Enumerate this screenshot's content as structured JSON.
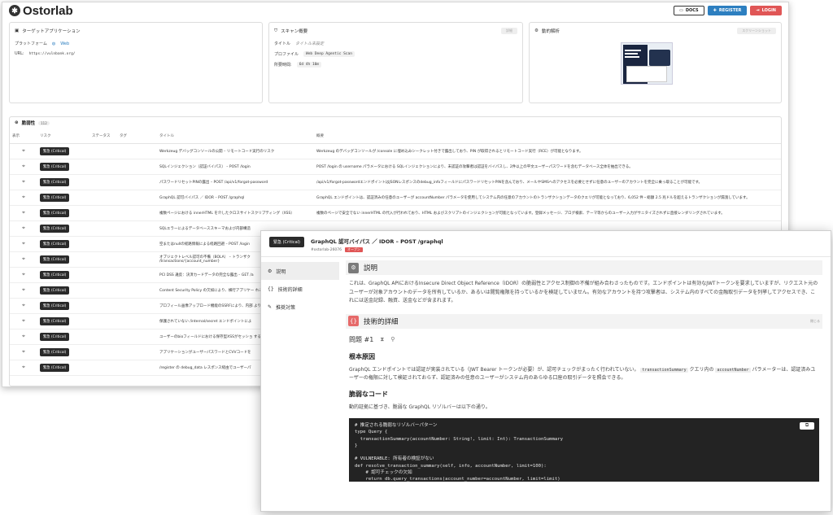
{
  "app": {
    "logo_text": "Ostorlab",
    "nav": {
      "docs": "DOCS",
      "register": "REGISTER",
      "login": "LOGIN"
    }
  },
  "target": {
    "title": "ターゲットアプリケーション",
    "platform_label": "プラットフォーム",
    "platform_value": "Web",
    "url_label": "URL:",
    "url_value": "https://vulnbank.org/"
  },
  "scan": {
    "title": "スキャン概要",
    "button": "詳細",
    "title_label": "タイトル",
    "title_value": "タイトル未設定",
    "profile_label": "プロファイル",
    "profile_value": "Web Deep Agentic Scan",
    "duration_label": "所要時間:",
    "duration_value": "6d 4h 10m"
  },
  "dynamic": {
    "title": "動的解析",
    "button": "スクリーンショット"
  },
  "vulnerabilities": {
    "title": "脆弱性",
    "count": "112",
    "columns": [
      "表示",
      "リスク",
      "ステータス",
      "タグ",
      "タイトル",
      "概要"
    ],
    "rows": [
      {
        "risk": "緊急 (Critical)",
        "title": "Werkzeug デバッグコンソールの公開 – リモートコード実行のリスク",
        "summary": "Werkzeug のデバッグコンソールが /console に埋め込みシークレット付きで露出しており、PIN が取得されるとリモートコード実行（RCE）が可能となります。"
      },
      {
        "risk": "緊急 (Critical)",
        "title": "SQLインジェクション（認証バイパス） – POST /login",
        "summary": "POST /login の username パラメータにおける SQLインジェクションにより、未認証の攻撃者は認証をバイパスし、2件以上の平文ユーザーパスワードを含むデータベース全体を抽出できる。"
      },
      {
        "risk": "緊急 (Critical)",
        "title": "パスワードリセットPINの露出 – POST /api/v1/forgot-password",
        "summary": "/api/v1/forgot-passwordエンドポイントはJSONレスポンスのdebug_infoフィールドにパスワードリセットPINを含んでおり、メールやSMSへのアクセスを必要とせずに任意のユーザーのアカウントを完全に乗っ取ることが可能です。"
      },
      {
        "risk": "緊急 (Critical)",
        "title": "GraphQL 認可バイパス ／ IDOR – POST /graphql",
        "summary": "GraphQL エンドポイントは、認証済みの任意のユーザーが accountNumber パラメータを使用してシステム内の任意のアカウントのトランザクションデータのクエリが可能となっており、6,052 件・総額 2.5 兆ドルを超えるトランザクションが漏洩しています。"
      },
      {
        "risk": "緊急 (Critical)",
        "title": "複数ページにおける innerHTML を介したクロスサイトスクリプティング（XSS）",
        "summary": "複数のページで安全でない innerHTML の代入が行われており、HTML およびスクリプトのインジェクションが可能となっています。登録メッセージ、ブログ検索、テーマ等からのユーザー入力がサニタイズされずに直接レンダリングされています。"
      },
      {
        "risk": "緊急 (Critical)",
        "title": "SQLエラーによるデータベーススキーマおよび内部構造",
        "summary": ""
      },
      {
        "risk": "緊急 (Critical)",
        "title": "空またはnullの経路情報による経路回避 – POST /login",
        "summary": ""
      },
      {
        "risk": "緊急 (Critical)",
        "title": "オブジェクトレベル認可の不備（BOLA） – トランザク /transactions/{account_number}",
        "summary": ""
      },
      {
        "risk": "緊急 (Critical)",
        "title": "PCI DSS 違反：決済カードデータの完全な露出 – GET /a",
        "summary": ""
      },
      {
        "risk": "緊急 (Critical)",
        "title": "Content Security Policy の欠如により、横行アプリケー れる",
        "summary": ""
      },
      {
        "risk": "緊急 (Critical)",
        "title": "プロフィール画像アップロード機能のSSRFにより、内部 より機密データの流出が可能",
        "summary": ""
      },
      {
        "risk": "緊急 (Critical)",
        "title": "保護されていない /internal/secret エンドポイントによ",
        "summary": ""
      },
      {
        "risk": "緊急 (Critical)",
        "title": "ユーザーのbioフィールドにおける保存型XSSがセッショ する",
        "summary": ""
      },
      {
        "risk": "緊急 (Critical)",
        "title": "アプリケーションがユーザーパスワードとCVVコードを",
        "summary": ""
      },
      {
        "risk": "緊急 (Critical)",
        "title": "/register の debug_data レスポンス経由でユーザーパ",
        "summary": ""
      }
    ]
  },
  "detail": {
    "badge": "緊急 (Critical)",
    "title": "GraphQL 認可バイパス ／ IDOR – POST /graphql",
    "id": "#ostorlab-26076",
    "status": "オープン",
    "sidebar": [
      "説明",
      "技術的詳細",
      "推奨対策"
    ],
    "description_title": "説明",
    "description": "これは、GraphQL APIにおけるInsecure Direct Object Reference（IDOR）の脆弱性とアクセス制御の不備が組み合わさったものです。エンドポイントは有効なJWTトークンを要求していますが、リクエスト元のユーザーが対象アカウントのデータを所有しているか、あるいは閲覧権限を持っているかを検証していません。有効なアカウントを持つ攻撃者は、システム内のすべての金融取引データを列挙してアクセスでき、これには送金記録、融資、送金などが含まれます。",
    "technical_title": "技術的詳細",
    "close_label": "閉じる",
    "issue_label": "問題 #1",
    "root_cause_title": "根本原因",
    "root_cause_1": "GraphQL エンドポイントでは認証が実装されている（JWT Bearer トークンが必要）が、認可チェックがまったく行われていない。",
    "root_cause_code1": "transactionSummary",
    "root_cause_2": " クエリ内の ",
    "root_cause_code2": "accountNumber",
    "root_cause_3": " パラメーターは、認証済みユーザーの権限に対して検証されておらず、認証済みの任意のユーザーがシステム内のあらゆる口座の取引データを照会できる。",
    "vuln_code_title": "脆弱なコード",
    "vuln_code_desc": "動的証拠に基づき、脆弱な GraphQL リゾルバーは以下の通り。",
    "code": "# 推定される脆弱なリゾルバーパターン\ntype Query {\n  transactionSummary(accountNumber: String!, limit: Int): TransactionSummary\n}\n\n# VULNERABLE: 所有者の検証がない\ndef resolve_transaction_summary(self, info, accountNumber, limit=100):\n    # 認可チェックの欠如\n    return db.query_transactions(account_number=accountNumber, limit=limit)"
  }
}
